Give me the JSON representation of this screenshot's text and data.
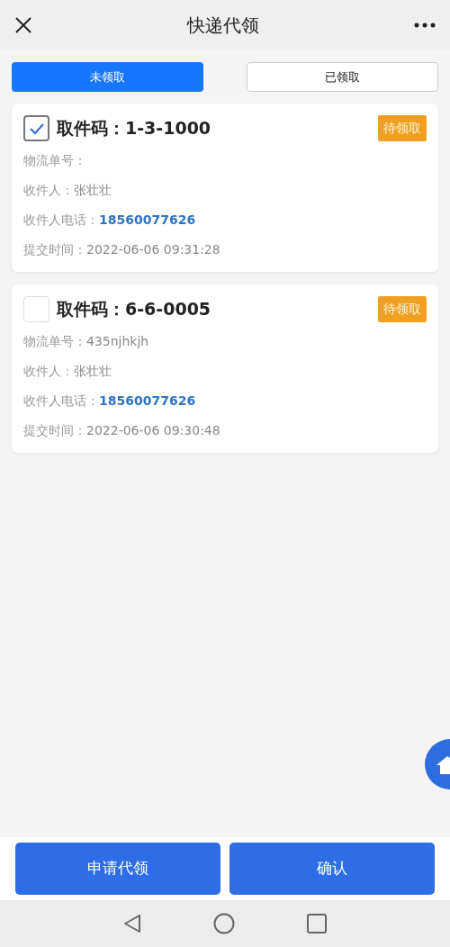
{
  "header": {
    "title": "快递代领"
  },
  "tabs": [
    {
      "label": "未领取",
      "selected": true
    },
    {
      "label": "已领取",
      "selected": false
    }
  ],
  "parcels": [
    {
      "checked": true,
      "code": "取件码：1-3-1000",
      "status": "待领取",
      "fields": [
        {
          "kind": "text",
          "label": "物流单号："
        },
        {
          "kind": "text",
          "label": "收件人：",
          "value": "张壮壮"
        },
        {
          "kind": "phone",
          "label": "收件人电话：",
          "value": "18560077626"
        },
        {
          "kind": "text",
          "label": "提交时间：",
          "value": "2022-06-06 09:31:28"
        }
      ]
    },
    {
      "checked": false,
      "code": "取件码：6-6-0005",
      "status": "待领取",
      "fields": [
        {
          "kind": "text",
          "label": "物流单号：",
          "value": "435njhkjh"
        },
        {
          "kind": "text",
          "label": "收件人：",
          "value": "张壮壮"
        },
        {
          "kind": "phone",
          "label": "收件人电话：",
          "value": "18560077626"
        },
        {
          "kind": "text",
          "label": "提交时间：",
          "value": "2022-06-06 09:30:48"
        }
      ]
    }
  ],
  "buttons": [
    "申请代领",
    "确认"
  ]
}
